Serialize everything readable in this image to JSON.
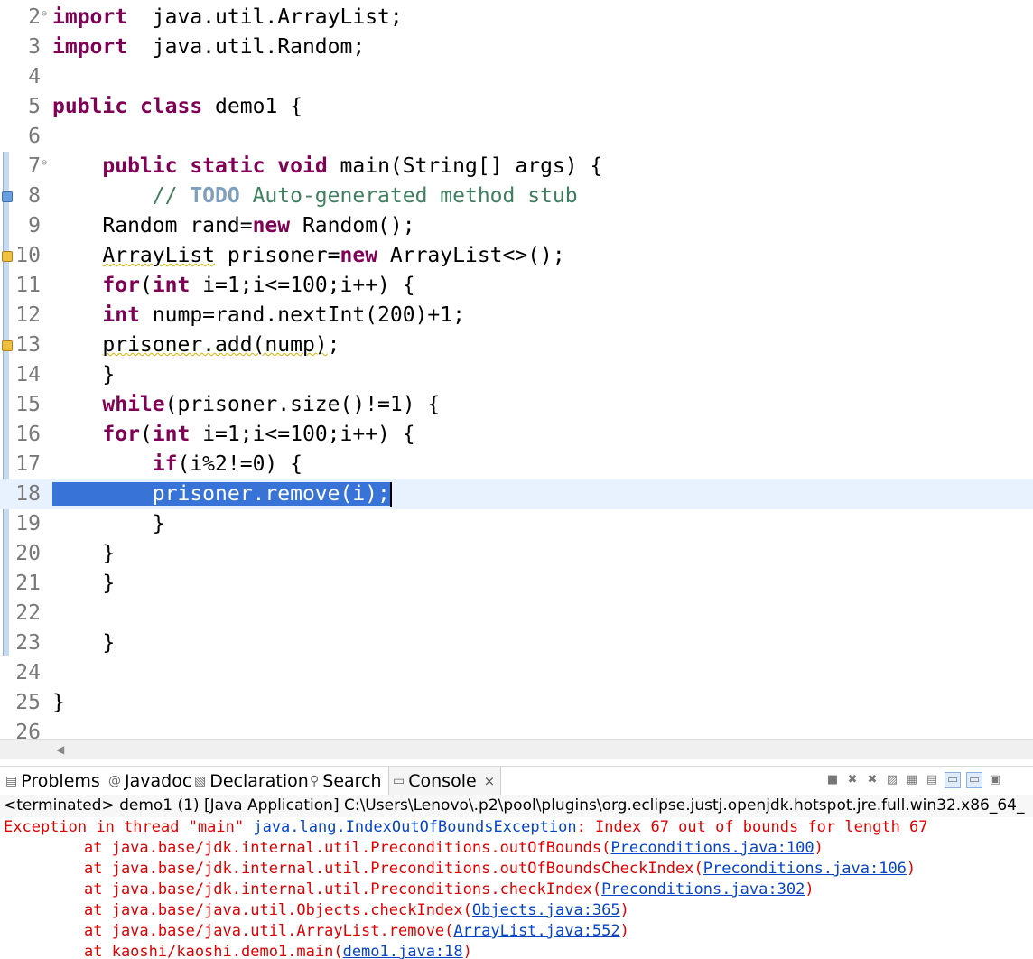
{
  "editor": {
    "lines": [
      {
        "n": "2",
        "segs": [
          [
            "kw",
            "import"
          ],
          [
            "",
            "  java.util.ArrayList;"
          ]
        ],
        "fold": "⊖"
      },
      {
        "n": "3",
        "segs": [
          [
            "kw",
            "import"
          ],
          [
            "",
            "  java.util.Random;"
          ]
        ]
      },
      {
        "n": "4",
        "segs": []
      },
      {
        "n": "5",
        "segs": [
          [
            "kw",
            "public"
          ],
          [
            "",
            " "
          ],
          [
            "kw",
            "class"
          ],
          [
            "",
            " demo1 {"
          ]
        ]
      },
      {
        "n": "6",
        "segs": []
      },
      {
        "n": "7",
        "segs": [
          [
            "",
            "    "
          ],
          [
            "kw",
            "public"
          ],
          [
            "",
            " "
          ],
          [
            "kw",
            "static"
          ],
          [
            "",
            " "
          ],
          [
            "kw",
            "void"
          ],
          [
            "",
            " main(String[] args) {"
          ]
        ],
        "fold": "⊖"
      },
      {
        "n": "8",
        "segs": [
          [
            "",
            "        "
          ],
          [
            "cm",
            "// "
          ],
          [
            "td",
            "TODO"
          ],
          [
            "cm",
            " Auto-generated method stub"
          ]
        ],
        "marker": "task"
      },
      {
        "n": "9",
        "segs": [
          [
            "",
            "    Random rand="
          ],
          [
            "kw",
            "new"
          ],
          [
            "",
            " Random();"
          ]
        ]
      },
      {
        "n": "10",
        "segs": [
          [
            "",
            "    "
          ],
          [
            "wv",
            "ArrayList"
          ],
          [
            "",
            " prisoner="
          ],
          [
            "kw",
            "new"
          ],
          [
            "",
            " ArrayList<>();"
          ]
        ],
        "marker": "warn"
      },
      {
        "n": "11",
        "segs": [
          [
            "",
            "    "
          ],
          [
            "kw",
            "for"
          ],
          [
            "",
            "("
          ],
          [
            "kw",
            "int"
          ],
          [
            "",
            " i=1;i<=100;i++) {"
          ]
        ]
      },
      {
        "n": "12",
        "segs": [
          [
            "",
            "    "
          ],
          [
            "kw",
            "int"
          ],
          [
            "",
            " nump=rand.nextInt(200)+1;"
          ]
        ]
      },
      {
        "n": "13",
        "segs": [
          [
            "",
            "    "
          ],
          [
            "wv",
            "prisoner.add(nump)"
          ],
          [
            "",
            ";"
          ]
        ],
        "marker": "warn"
      },
      {
        "n": "14",
        "segs": [
          [
            "",
            "    }"
          ]
        ]
      },
      {
        "n": "15",
        "segs": [
          [
            "",
            "    "
          ],
          [
            "kw",
            "while"
          ],
          [
            "",
            "(prisoner.size()!=1) {"
          ]
        ]
      },
      {
        "n": "16",
        "segs": [
          [
            "",
            "    "
          ],
          [
            "kw",
            "for"
          ],
          [
            "",
            "("
          ],
          [
            "kw",
            "int"
          ],
          [
            "",
            " i=1;i<=100;i++) {"
          ]
        ]
      },
      {
        "n": "17",
        "segs": [
          [
            "",
            "        "
          ],
          [
            "kw",
            "if"
          ],
          [
            "",
            "(i%2!=0) {"
          ]
        ]
      },
      {
        "n": "18",
        "segs": [
          [
            "",
            "        "
          ],
          [
            "sel",
            "prisoner.remove(i);"
          ]
        ],
        "current": true,
        "selected_lead": "    "
      },
      {
        "n": "19",
        "segs": [
          [
            "",
            "        }"
          ]
        ]
      },
      {
        "n": "20",
        "segs": [
          [
            "",
            "    }"
          ]
        ]
      },
      {
        "n": "21",
        "segs": [
          [
            "",
            "    }"
          ]
        ]
      },
      {
        "n": "22",
        "segs": []
      },
      {
        "n": "23",
        "segs": [
          [
            "",
            "    }"
          ]
        ]
      },
      {
        "n": "24",
        "segs": []
      },
      {
        "n": "25",
        "segs": [
          [
            "",
            "}"
          ]
        ]
      },
      {
        "n": "26",
        "segs": []
      }
    ]
  },
  "views": {
    "tabs": [
      {
        "label": "Problems",
        "icon": "problems-icon",
        "glyph": "▤"
      },
      {
        "label": "Javadoc",
        "icon": "javadoc-icon",
        "glyph": "@"
      },
      {
        "label": "Declaration",
        "icon": "declaration-icon",
        "glyph": "▧"
      },
      {
        "label": "Search",
        "icon": "search-icon",
        "glyph": "⚲"
      },
      {
        "label": "Console",
        "icon": "console-icon",
        "glyph": "▭",
        "active": true
      }
    ],
    "toolbar": [
      {
        "name": "terminate-icon",
        "glyph": "■"
      },
      {
        "name": "remove-launch-icon",
        "glyph": "✖"
      },
      {
        "name": "remove-all-launches-icon",
        "glyph": "✖"
      },
      {
        "name": "clear-console-icon",
        "glyph": "▨"
      },
      {
        "name": "scroll-lock-icon",
        "glyph": "▦"
      },
      {
        "name": "word-wrap-icon",
        "glyph": "▤"
      },
      {
        "name": "show-on-stdout-icon",
        "glyph": "▭",
        "on": true
      },
      {
        "name": "show-on-stderr-icon",
        "glyph": "▭",
        "on": true
      },
      {
        "name": "pin-console-icon",
        "glyph": "▣"
      }
    ]
  },
  "console": {
    "header": "<terminated> demo1 (1) [Java Application] C:\\Users\\Lenovo\\.p2\\pool\\plugins\\org.eclipse.justj.openjdk.hotspot.jre.full.win32.x86_64_",
    "lines": [
      {
        "indent": false,
        "pre": "Exception in thread \"main\" ",
        "link": "java.lang.IndexOutOfBoundsException",
        "post": ": Index 67 out of bounds for length 67"
      },
      {
        "indent": true,
        "pre": "at java.base/jdk.internal.util.Preconditions.outOfBounds(",
        "link": "Preconditions.java:100",
        "post": ")"
      },
      {
        "indent": true,
        "pre": "at java.base/jdk.internal.util.Preconditions.outOfBoundsCheckIndex(",
        "link": "Preconditions.java:106",
        "post": ")"
      },
      {
        "indent": true,
        "pre": "at java.base/jdk.internal.util.Preconditions.checkIndex(",
        "link": "Preconditions.java:302",
        "post": ")"
      },
      {
        "indent": true,
        "pre": "at java.base/java.util.Objects.checkIndex(",
        "link": "Objects.java:365",
        "post": ")"
      },
      {
        "indent": true,
        "pre": "at java.base/java.util.ArrayList.remove(",
        "link": "ArrayList.java:552",
        "post": ")"
      },
      {
        "indent": true,
        "pre": "at kaoshi/kaoshi.demo1.main(",
        "link": "demo1.java:18",
        "post": ")"
      }
    ]
  }
}
